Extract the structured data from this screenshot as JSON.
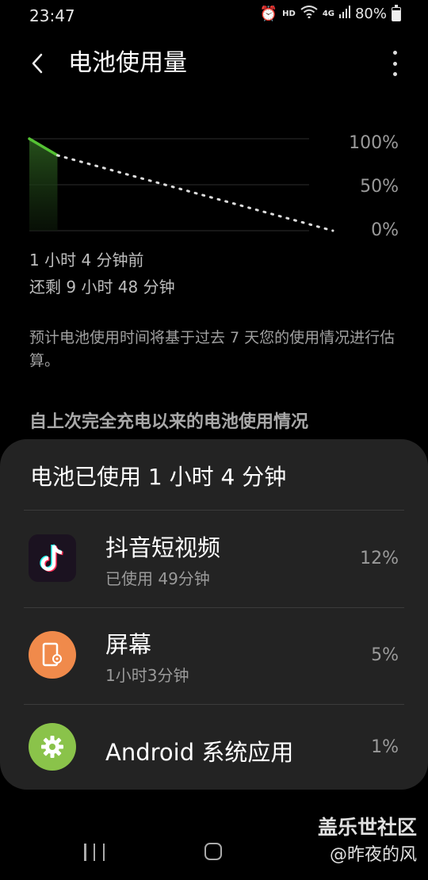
{
  "status_bar": {
    "time": "23:47",
    "hd": "HD",
    "network": "4G",
    "battery": "80%"
  },
  "header": {
    "title": "电池使用量"
  },
  "chart_data": {
    "type": "line",
    "y_ticks": [
      "100%",
      "50%",
      "0%"
    ],
    "ylim": [
      0,
      100
    ],
    "series": [
      {
        "style": "solid",
        "color": "#55c234",
        "points": [
          [
            0,
            100
          ],
          [
            1,
            82
          ]
        ]
      },
      {
        "style": "dotted",
        "color": "#dddddd",
        "points": [
          [
            1,
            82
          ],
          [
            10.8,
            0
          ]
        ]
      }
    ],
    "xlim": [
      0,
      10.8
    ]
  },
  "summary": {
    "time_ago": "1 小时 4 分钟前",
    "remaining": "还剩 9 小时 48 分钟"
  },
  "description": "预计电池使用时间将基于过去 7 天您的使用情况进行估算。",
  "section_title": "自上次完全充电以来的电池使用情况",
  "sheet": {
    "title": "电池已使用 1 小时 4 分钟",
    "apps": [
      {
        "name": "抖音短视频",
        "usage": "已使用 49分钟",
        "percent": "12%",
        "icon": "tiktok-icon"
      },
      {
        "name": "屏幕",
        "usage": "1小时3分钟",
        "percent": "5%",
        "icon": "screen-icon"
      },
      {
        "name": "Android 系统应用",
        "usage": "",
        "percent": "1%",
        "icon": "gear-icon"
      }
    ]
  },
  "watermark": {
    "line1": "盖乐世社区",
    "line2": "@昨夜的风"
  },
  "colors": {
    "accent_green": "#55c234",
    "screen_icon_bg": "#f08a4b",
    "android_icon_bg": "#8ac34a"
  }
}
